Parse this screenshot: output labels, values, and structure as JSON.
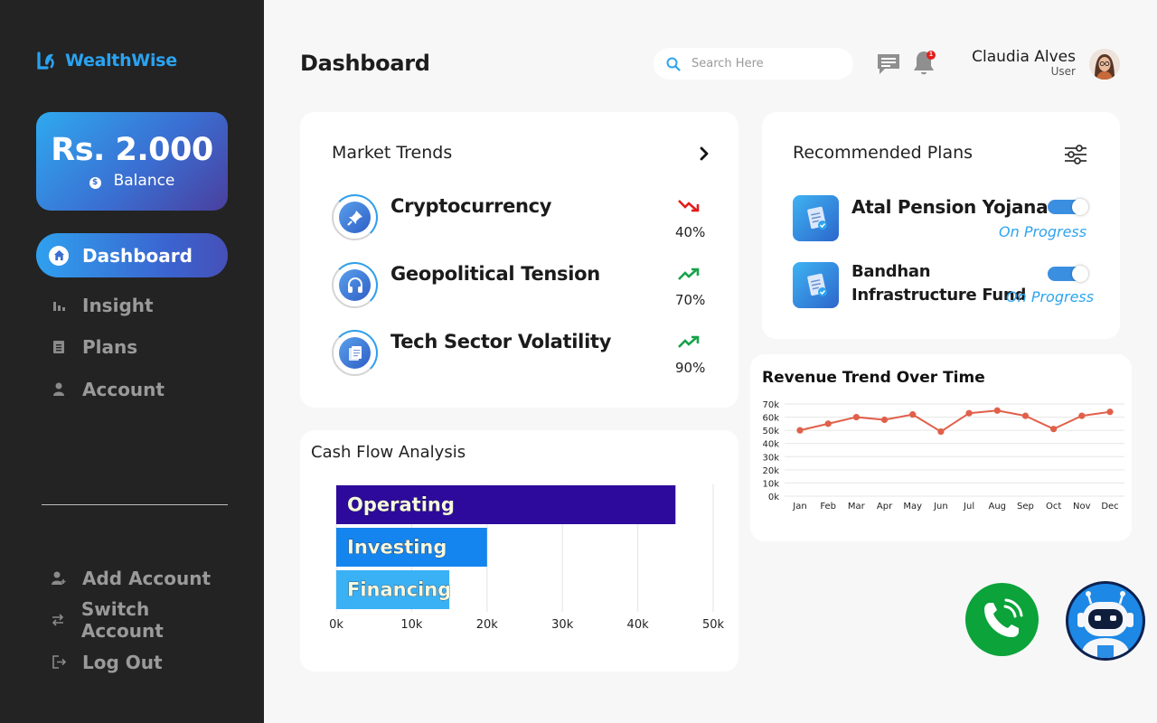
{
  "app": {
    "name": "WealthWise",
    "brand_color": "#2aa3f2"
  },
  "balance": {
    "amount": "Rs. 2.000",
    "label": "Balance"
  },
  "nav": {
    "primary": [
      {
        "label": "Dashboard",
        "icon": "home-icon",
        "active": true
      },
      {
        "label": "Insight",
        "icon": "bar-chart-icon",
        "active": false
      },
      {
        "label": "Plans",
        "icon": "document-icon",
        "active": false
      },
      {
        "label": "Account",
        "icon": "user-icon",
        "active": false
      }
    ],
    "secondary": [
      {
        "label": "Add Account",
        "icon": "add-user-icon"
      },
      {
        "label": "Switch Account",
        "icon": "swap-icon"
      },
      {
        "label": "Log Out",
        "icon": "logout-icon"
      }
    ]
  },
  "header": {
    "title": "Dashboard",
    "search_placeholder": "Search Here",
    "notification_count": "1",
    "user_name": "Claudia Alves",
    "user_role": "User"
  },
  "market_trends": {
    "title": "Market Trends",
    "items": [
      {
        "name": "Cryptocurrency",
        "percent": "40%",
        "direction": "down",
        "icon": "pushpin-icon"
      },
      {
        "name": "Geopolitical Tension",
        "percent": "70%",
        "direction": "up",
        "icon": "headphones-icon"
      },
      {
        "name": "Tech Sector Volatility",
        "percent": "90%",
        "direction": "up",
        "icon": "documents-icon"
      }
    ],
    "colors": {
      "up": "#16a34a",
      "down": "#e11d1d"
    }
  },
  "recommended_plans": {
    "title": "Recommended Plans",
    "items": [
      {
        "name": "Atal Pension Yojana",
        "status": "On Progress",
        "toggle_on": true
      },
      {
        "name_line1": "Bandhan",
        "name_line2": "Infrastructure Fund",
        "status": "On Progress",
        "toggle_on": true
      }
    ]
  },
  "cash_flow": {
    "title": "Cash Flow Analysis",
    "chart_data": {
      "type": "bar",
      "orientation": "horizontal",
      "categories": [
        "Operating",
        "Investing",
        "Financing"
      ],
      "values": [
        45000,
        20000,
        15000
      ],
      "colors": [
        "#2e0a9c",
        "#1484ee",
        "#3ab0f5"
      ],
      "xlim": [
        0,
        50000
      ],
      "xticks": [
        "0k",
        "10k",
        "20k",
        "30k",
        "40k",
        "50k"
      ],
      "grid": true
    }
  },
  "revenue": {
    "title": "Revenue Trend Over Time",
    "chart_data": {
      "type": "line",
      "categories": [
        "Jan",
        "Feb",
        "Mar",
        "Apr",
        "May",
        "Jun",
        "Jul",
        "Aug",
        "Sep",
        "Oct",
        "Nov",
        "Dec"
      ],
      "values": [
        50000,
        55000,
        60000,
        58000,
        62000,
        49000,
        63000,
        65000,
        61000,
        51000,
        61000,
        64000
      ],
      "color": "#e0604a",
      "ylim": [
        0,
        70000
      ],
      "yticks": [
        "0k",
        "10k",
        "20k",
        "30k",
        "40k",
        "50k",
        "60k",
        "70k"
      ],
      "grid": true
    }
  },
  "fabs": {
    "call_icon": "phone-call-icon",
    "bot_icon": "robot-icon"
  }
}
